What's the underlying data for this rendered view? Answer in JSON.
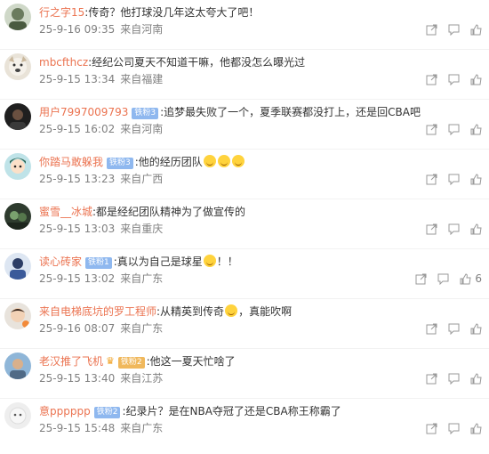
{
  "comments": [
    {
      "username": "行之字15",
      "text": ":传奇？他打球没几年这太夸大了吧！",
      "date": "25-9-16 09:35",
      "source": "来自河南"
    },
    {
      "username": "mbcfthcz",
      "text": ":经纪公司夏天不知道干嘛，他都没怎么曝光过",
      "date": "25-9-15 13:34",
      "source": "来自福建"
    },
    {
      "username": "用户7997009793",
      "badge": "铁粉3",
      "text": ":追梦最失败了一个，夏季联赛都没打上，还是回CBA吧",
      "date": "25-9-15 16:02",
      "source": "来自河南"
    },
    {
      "username": "你踏马敢躲我",
      "badge": "铁粉3",
      "text": ":他的经历团队",
      "date": "25-9-15 13:23",
      "source": "来自广西"
    },
    {
      "username": "蜜雪__冰城",
      "text": ":都是经纪团队精神为了做宣传的",
      "date": "25-9-15 13:03",
      "source": "来自重庆"
    },
    {
      "username": "读心砖家",
      "badge": "铁粉1",
      "text_before": ":真以为自己是球星",
      "text_after": "！！",
      "date": "25-9-15 13:02",
      "source": "来自广东",
      "like_count": "6"
    },
    {
      "username": "来自电梯底坑的罗工程师",
      "text_before": ":从精英到传奇",
      "text_after": "，真能吹啊",
      "date": "25-9-16 08:07",
      "source": "来自广东"
    },
    {
      "username": "老汉推了飞机",
      "badge": "铁粉2",
      "text": ":他这一夏天忙啥了",
      "date": "25-9-15 13:40",
      "source": "来自江苏"
    },
    {
      "username": "意pppppp",
      "badge": "铁粉2",
      "text": ":纪录片？是在NBA夺冠了还是CBA称王称霸了",
      "date": "25-9-15 15:48",
      "source": "来自广东"
    }
  ]
}
